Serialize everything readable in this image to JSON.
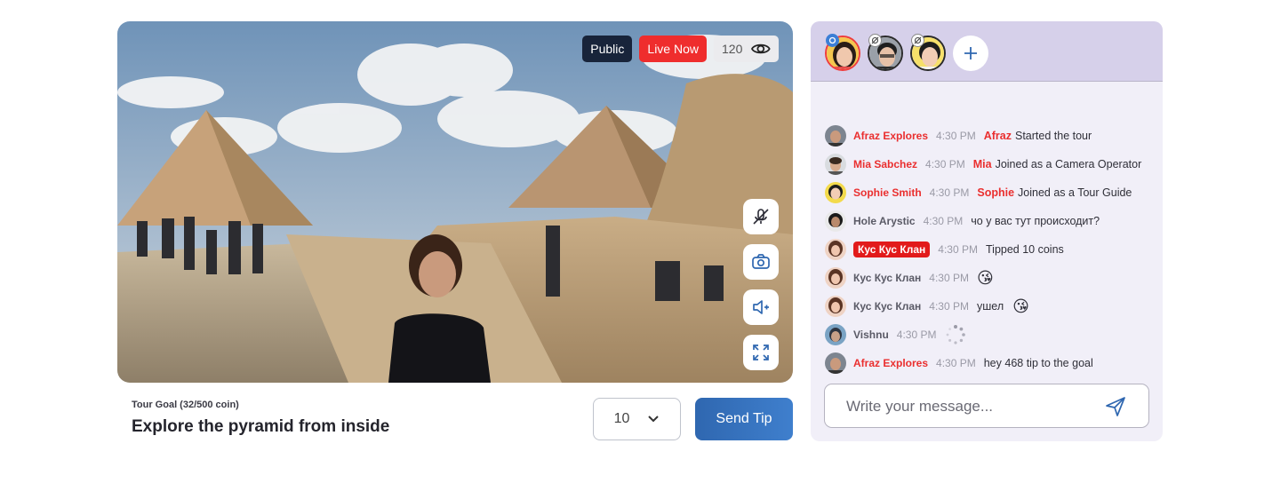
{
  "video": {
    "visibility": "Public",
    "live_label": "Live Now",
    "viewer_count": "120"
  },
  "goal": {
    "label": "Tour Goal (32/500 coin)",
    "title": "Explore the pyramid from inside"
  },
  "tip": {
    "amount": "10",
    "send_label": "Send Tip"
  },
  "chat": {
    "messages": [
      {
        "name": "Afraz Explores",
        "time": "4:30 PM",
        "mention": "Afraz",
        "text": "Started the tour"
      },
      {
        "name": "Mia Sabchez",
        "time": "4:30 PM",
        "mention": "Mia",
        "text": "Joined as a Camera Operator"
      },
      {
        "name": "Sophie Smith",
        "time": "4:30 PM",
        "mention": "Sophie",
        "text": "Joined as a Tour Guide"
      },
      {
        "name": "Hole Arystic",
        "time": "4:30 PM",
        "text": "чо у вас тут происходит?"
      },
      {
        "name": "Кус Кус Клан",
        "time": "4:30 PM",
        "text": "Tipped 10 coins"
      },
      {
        "name": "Кус Кус Клан",
        "time": "4:30 PM",
        "emoji": "😘"
      },
      {
        "name": "Кус Кус Клан",
        "time": "4:30 PM",
        "text": "ушел",
        "emoji": "😘"
      },
      {
        "name": "Vishnu",
        "time": "4:30 PM"
      },
      {
        "name": "Afraz Explores",
        "time": "4:30 PM",
        "text": "hey 468 tip to the goal"
      }
    ],
    "composer_placeholder": "Write your message..."
  },
  "colors": {
    "accent_red": "#ef2d2d",
    "send_tip_blue": "#3a74c1",
    "chat_bg": "#f1eff8",
    "chat_header": "#d6d0ea"
  }
}
